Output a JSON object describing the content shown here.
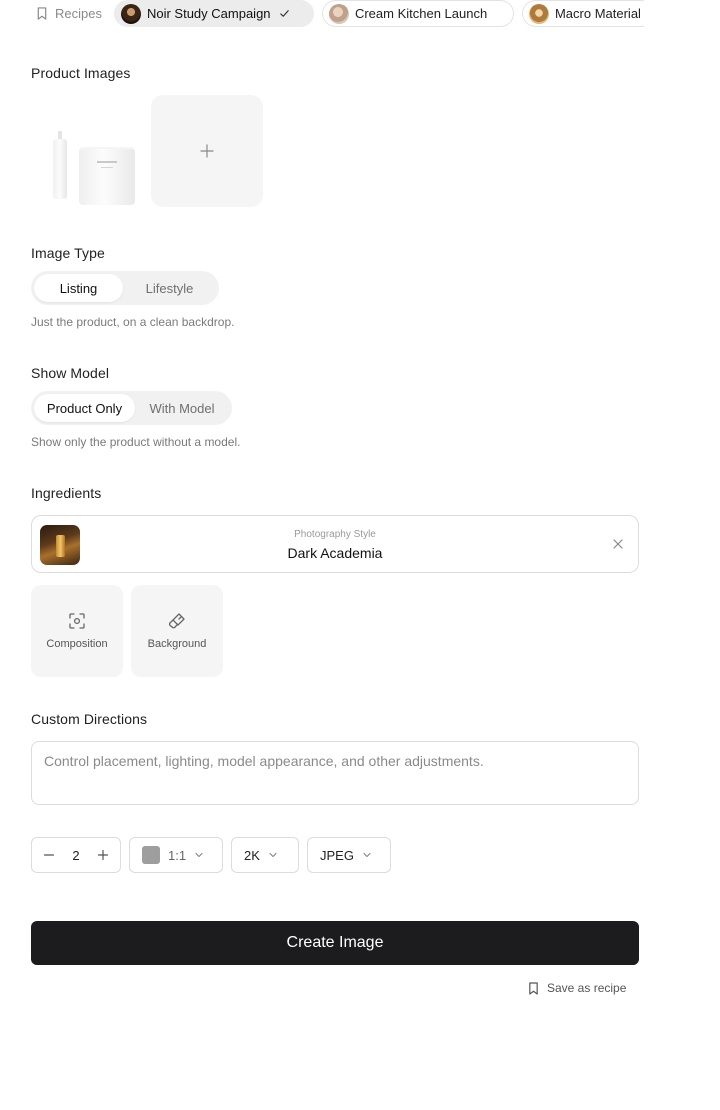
{
  "recipes": {
    "label": "Recipes",
    "items": [
      {
        "label": "Noir Study Campaign",
        "active": true
      },
      {
        "label": "Cream Kitchen Launch",
        "active": false
      },
      {
        "label": "Macro Material",
        "active": false
      }
    ]
  },
  "product_images": {
    "title": "Product Images"
  },
  "image_type": {
    "title": "Image Type",
    "options": [
      "Listing",
      "Lifestyle"
    ],
    "selected": "Listing",
    "helper": "Just the product, on a clean backdrop."
  },
  "show_model": {
    "title": "Show Model",
    "options": [
      "Product Only",
      "With Model"
    ],
    "selected": "Product Only",
    "helper": "Show only the product without a model."
  },
  "ingredients": {
    "title": "Ingredients",
    "card": {
      "subtitle": "Photography Style",
      "title": "Dark Academia"
    },
    "tiles": [
      "Composition",
      "Background"
    ]
  },
  "custom_directions": {
    "title": "Custom Directions",
    "placeholder": "Control placement, lighting, model appearance, and other adjustments.",
    "value": ""
  },
  "controls": {
    "count": "2",
    "ratio": "1:1",
    "resolution": "2K",
    "format": "JPEG",
    "swatch_color": "#9e9e9e"
  },
  "actions": {
    "create_label": "Create Image",
    "save_recipe_label": "Save as recipe"
  }
}
